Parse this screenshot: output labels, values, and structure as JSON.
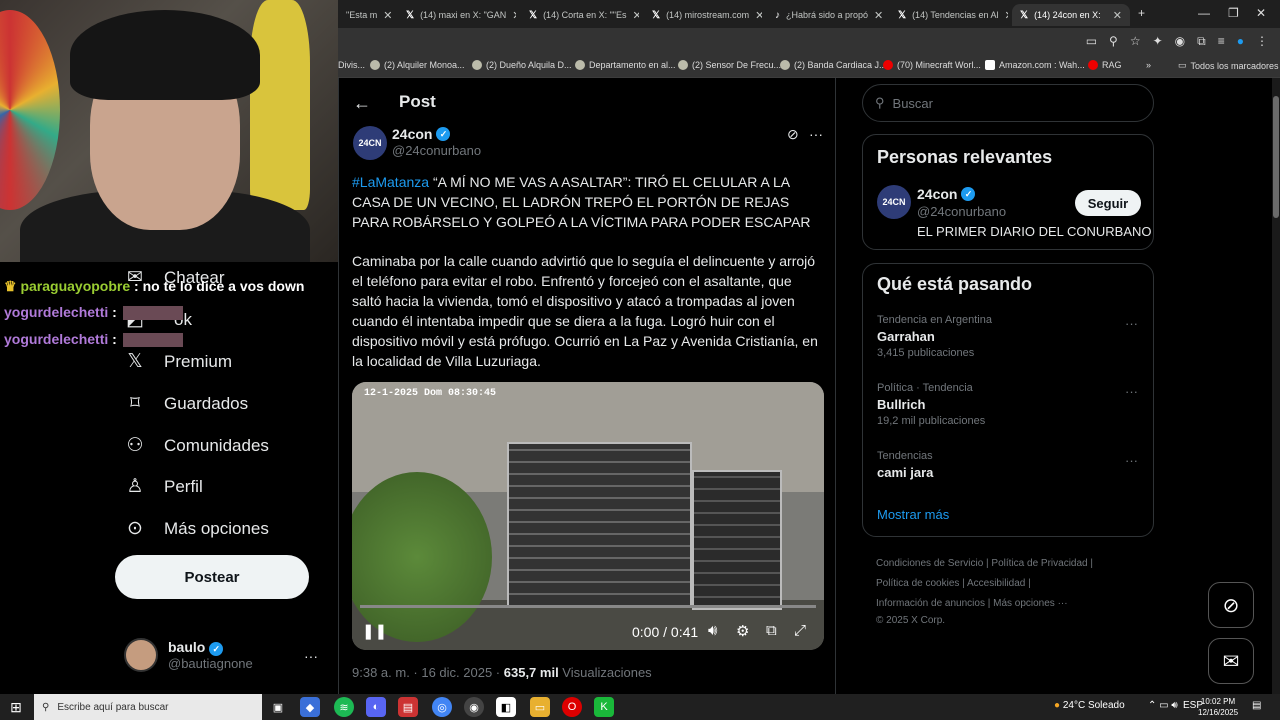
{
  "browser": {
    "tabs": [
      {
        "label": "\"Esta m",
        "active": false
      },
      {
        "label": "(14) maxi en X: \"GAN",
        "active": false
      },
      {
        "label": "(14) Corta en X: \"\"Es",
        "active": false
      },
      {
        "label": "(14) mirostream.com",
        "active": false
      },
      {
        "label": "¿Habrá sido a propó",
        "active": false
      },
      {
        "label": "(14) Tendencias en Al",
        "active": false
      },
      {
        "label": "(14) 24con en X:",
        "active": true
      }
    ],
    "new_tab": "+",
    "window_controls": {
      "minimize": "—",
      "restore": "❐",
      "close": "✕"
    },
    "bookmarks": [
      "Divis...",
      "(2) Alquiler Monoa...",
      "(2) Dueño Alquila D...",
      "Departamento en al...",
      "(2) Sensor De Frecu...",
      "(2) Banda Cardiaca J...",
      "(70) Minecraft Worl...",
      "Amazon.com : Wah...",
      "RAG"
    ],
    "bookmarks_more": "»",
    "all_bookmarks": "Todos los marcadores"
  },
  "stream": {
    "chat": [
      {
        "user": "paraguayopobre",
        "message": ": no te lo dice a vos down",
        "color": "#9acd32"
      },
      {
        "user": "yogurdelechetti",
        "message": ":",
        "color": "#b07ad9"
      },
      {
        "user": "yogurdelechetti",
        "message": ":",
        "color": "#b07ad9"
      }
    ]
  },
  "sidebar": {
    "items": [
      {
        "label": "Chatear",
        "icon": "mail-icon"
      },
      {
        "label": "ok",
        "icon": "grok-icon"
      },
      {
        "label": "Premium",
        "icon": "x-logo-icon"
      },
      {
        "label": "Guardados",
        "icon": "bookmark-icon"
      },
      {
        "label": "Comunidades",
        "icon": "communities-icon"
      },
      {
        "label": "Perfil",
        "icon": "person-icon"
      },
      {
        "label": "Más opciones",
        "icon": "more-circle-icon"
      }
    ],
    "post_button": "Postear",
    "account": {
      "name": "baulo",
      "handle": "@bautiagnone",
      "more": "···"
    }
  },
  "post": {
    "header_title": "Post",
    "author": {
      "avatar_text": "24CN",
      "name": "24con",
      "handle": "@24conurbano"
    },
    "hashtag": "#LaMatanza",
    "headline": " “A MÍ NO ME VAS A ASALTAR”: TIRÓ EL CELULAR A LA CASA DE UN VECINO, EL LADRÓN TREPÓ EL PORTÓN DE REJAS PARA ROBÁRSELO Y GOLPEÓ A LA VÍCTIMA PARA PODER ESCAPAR",
    "body": "Caminaba por la calle cuando advirtió que lo seguía el delincuente y arrojó el teléfono para evitar el robo. Enfrentó y forcejeó con el asaltante, que saltó hacia la vivienda, tomó el dispositivo y atacó a trompadas al joven cuando él intentaba impedir que se diera a la fuga. Logró huir con el dispositivo móvil y está prófugo. Ocurrió en La Paz y Avenida Cristianía, en la localidad de Villa Luzuriaga.",
    "video": {
      "timestamp_overlay": "12-1-2025 Dom  08:30:45",
      "time": "0:00 / 0:41",
      "progress": 0.0
    },
    "meta_time": "9:38 a. m. · 16 dic. 2025 · ",
    "views": "635,7 mil",
    "views_label": " Visualizaciones"
  },
  "right": {
    "search_placeholder": "Buscar",
    "relevant": {
      "title": "Personas relevantes",
      "avatar_text": "24CN",
      "name": "24con",
      "handle": "@24conurbano",
      "description": "EL PRIMER DIARIO DEL CONURBANO",
      "follow": "Seguir"
    },
    "trending": {
      "title": "Qué está pasando",
      "items": [
        {
          "context": "Tendencia en Argentina",
          "title": "Garrahan",
          "count": "3,415 publicaciones"
        },
        {
          "context": "Política · Tendencia",
          "title": "Bullrich",
          "count": "19,2 mil publicaciones"
        },
        {
          "context": "Tendencias",
          "title": "cami jara",
          "count": ""
        }
      ],
      "show_more": "Mostrar más"
    },
    "footer": {
      "line1": "Condiciones de Servicio  |  Política de Privacidad  |",
      "line2": "Política de cookies  |  Accesibilidad  |",
      "line3": "Información de anuncios  |  Más opciones ···",
      "line4": "© 2025 X Corp."
    }
  },
  "taskbar": {
    "search_placeholder": "Escribe aquí para buscar",
    "weather": "24°C  Soleado",
    "lang": "ESP",
    "time": "10:02 PM",
    "date": "12/16/2025"
  },
  "colors": {
    "accent": "#1d9bf0",
    "background": "#000000",
    "border": "#2f3336"
  }
}
